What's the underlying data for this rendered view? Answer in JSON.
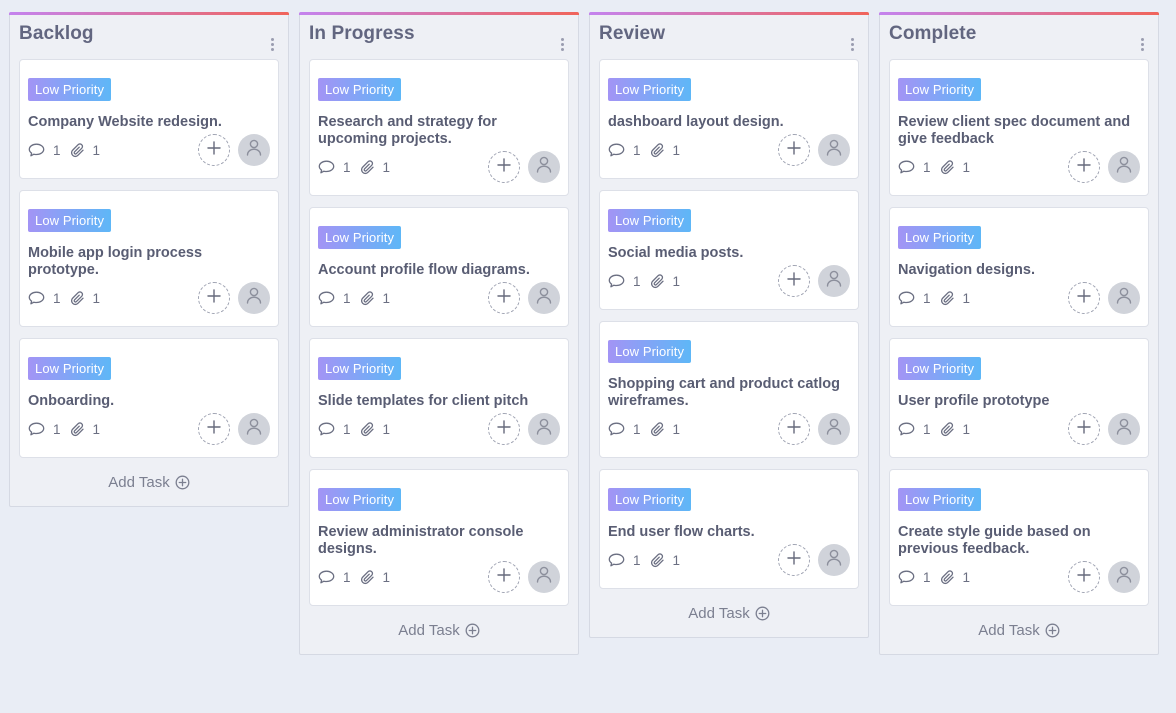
{
  "colors": {
    "accent_gradient_start": "#c483ee",
    "accent_gradient_end": "#f0645a",
    "badge_gradient_start": "#a394f5",
    "badge_gradient_end": "#5eb7f7"
  },
  "columns": [
    {
      "title": "Backlog",
      "add_task_label": "Add Task",
      "cards": [
        {
          "priority": "Low Priority",
          "title": "Company Website redesign.",
          "comments": "1",
          "attachments": "1"
        },
        {
          "priority": "Low Priority",
          "title": "Mobile app login process prototype.",
          "comments": "1",
          "attachments": "1"
        },
        {
          "priority": "Low Priority",
          "title": "Onboarding.",
          "comments": "1",
          "attachments": "1"
        }
      ]
    },
    {
      "title": "In Progress",
      "add_task_label": "Add Task",
      "cards": [
        {
          "priority": "Low Priority",
          "title": "Research and strategy for upcoming projects.",
          "comments": "1",
          "attachments": "1"
        },
        {
          "priority": "Low Priority",
          "title": "Account profile flow diagrams.",
          "comments": "1",
          "attachments": "1"
        },
        {
          "priority": "Low Priority",
          "title": "Slide templates for client pitch",
          "comments": "1",
          "attachments": "1"
        },
        {
          "priority": "Low Priority",
          "title": "Review administrator console designs.",
          "comments": "1",
          "attachments": "1"
        }
      ]
    },
    {
      "title": "Review",
      "add_task_label": "Add Task",
      "cards": [
        {
          "priority": "Low Priority",
          "title": "dashboard layout design.",
          "comments": "1",
          "attachments": "1"
        },
        {
          "priority": "Low Priority",
          "title": "Social media posts.",
          "comments": "1",
          "attachments": "1"
        },
        {
          "priority": "Low Priority",
          "title": "Shopping cart and product catlog wireframes.",
          "comments": "1",
          "attachments": "1"
        },
        {
          "priority": "Low Priority",
          "title": "End user flow charts.",
          "comments": "1",
          "attachments": "1"
        }
      ]
    },
    {
      "title": "Complete",
      "add_task_label": "Add Task",
      "cards": [
        {
          "priority": "Low Priority",
          "title": "Review client spec document and give feedback",
          "comments": "1",
          "attachments": "1"
        },
        {
          "priority": "Low Priority",
          "title": "Navigation designs.",
          "comments": "1",
          "attachments": "1"
        },
        {
          "priority": "Low Priority",
          "title": "User profile prototype",
          "comments": "1",
          "attachments": "1"
        },
        {
          "priority": "Low Priority",
          "title": "Create style guide based on previous feedback.",
          "comments": "1",
          "attachments": "1"
        }
      ]
    }
  ]
}
